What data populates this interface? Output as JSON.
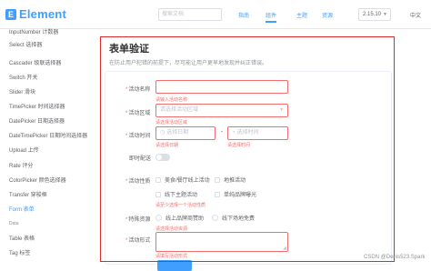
{
  "header": {
    "logo_mark": "E",
    "logo_text": "Element",
    "search_placeholder": "搜索文档",
    "nav": [
      "指南",
      "组件",
      "主题",
      "资源"
    ],
    "active_nav": "组件",
    "version": "2.15.10",
    "lang": "中文"
  },
  "sidebar": {
    "items": [
      "InputNumber 计数器",
      "Select 选择器",
      "Cascader 级联选择器",
      "Switch 开关",
      "Slider 滑块",
      "TimePicker 时间选择器",
      "DatePicker 日期选择器",
      "DateTimePicker 日期时间选择器",
      "Upload 上传",
      "Rate 评分",
      "ColorPicker 颜色选择器",
      "Transfer 穿梭框",
      "Form 表单"
    ],
    "group_label": "Data",
    "group_items": [
      "Table 表格",
      "Tag 标签"
    ],
    "active_item": "Form 表单"
  },
  "main": {
    "title": "表单验证",
    "description": "在防止用户犯错的前提下，尽可能让用户更早地发现并纠正错误。"
  },
  "form": {
    "name": {
      "label": "活动名称",
      "error": "请输入活动名称"
    },
    "region": {
      "label": "活动区域",
      "placeholder": "请选择活动区域",
      "error": "请选择活动区域"
    },
    "time": {
      "label": "活动时间",
      "date_placeholder": "选择日期",
      "time_placeholder": "选择时间",
      "separator": "-",
      "date_error": "请选择日期",
      "time_error": "请选择时间"
    },
    "delivery": {
      "label": "即时配送"
    },
    "type": {
      "label": "活动性质",
      "options": [
        "美食/餐厅线上活动",
        "地推活动",
        "线下主题活动",
        "单纯品牌曝光"
      ],
      "error": "请至少选择一个活动性质"
    },
    "resource": {
      "label": "特殊资源",
      "options": [
        "线上品牌商赞助",
        "线下场地免费"
      ],
      "error": "请选择活动资源"
    },
    "desc": {
      "label": "活动形式",
      "error": "请填写活动形式"
    }
  },
  "watermark": "CSDN @Denis523.Spark",
  "colors": {
    "primary": "#409eff",
    "danger": "#f56c6c",
    "highlight": "#e0282e"
  }
}
